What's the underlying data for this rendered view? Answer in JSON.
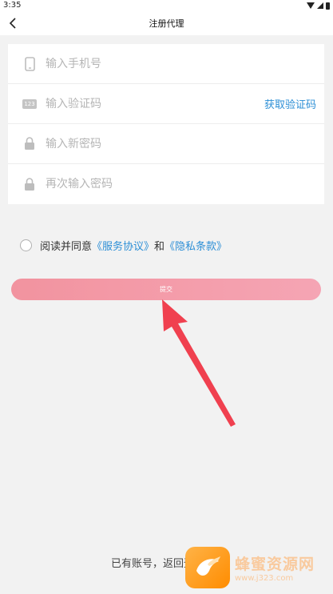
{
  "status_bar": {
    "time": "3:35"
  },
  "nav": {
    "title": "注册代理"
  },
  "form": {
    "phone_placeholder": "输入手机号",
    "code_placeholder": "输入验证码",
    "code_badge": "123",
    "get_code_label": "获取验证码",
    "password_placeholder": "输入新密码",
    "confirm_placeholder": "再次输入密码"
  },
  "agreement": {
    "prefix": "阅读并同意",
    "service_link": "《服务协议》",
    "and": "和",
    "privacy_link": "《隐私条款》"
  },
  "submit_label": "提交",
  "footer": {
    "text": "已有账号，返回登"
  },
  "watermark": {
    "title": "蜂蜜资源网",
    "url": "www.j323.com"
  },
  "colors": {
    "accent": "#2d8fd6",
    "submit_start": "#f2939f",
    "submit_end": "#f5a5b4",
    "arrow": "#f0404f",
    "background": "#f2f2f2"
  },
  "icons": {
    "back": "chevron-left-icon",
    "phone": "phone-icon",
    "code": "number-badge-icon",
    "lock": "lock-icon",
    "arrow": "arrow-icon"
  }
}
